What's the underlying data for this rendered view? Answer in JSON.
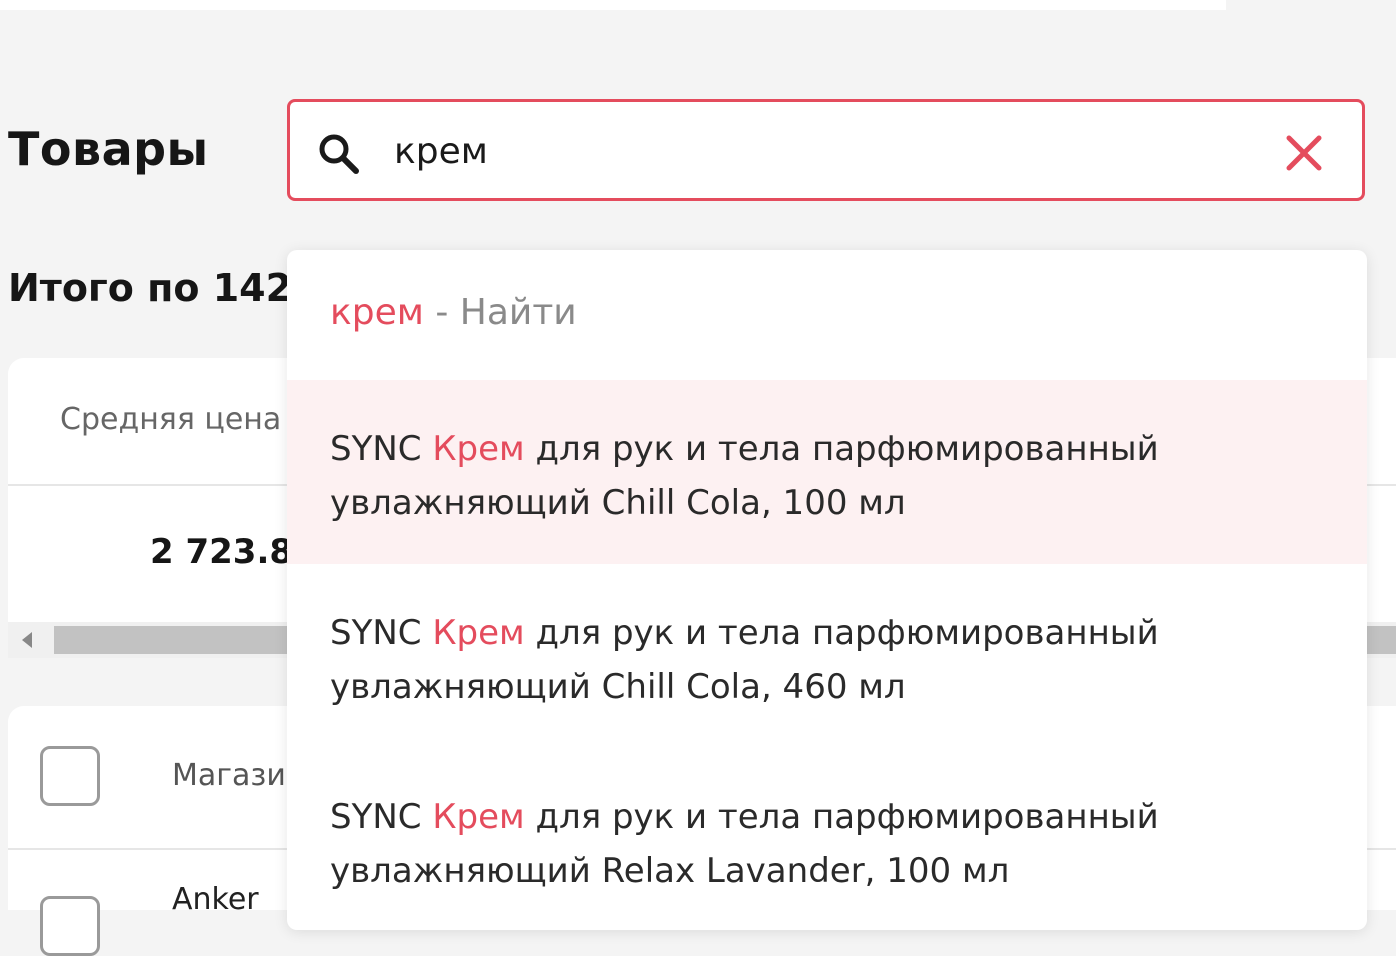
{
  "colors": {
    "accent": "#e44c5d",
    "hover_bg": "#fdf1f2",
    "page_bg": "#f4f4f4"
  },
  "page": {
    "title": "Товары"
  },
  "search": {
    "value": "крем",
    "icon": "search-icon",
    "clear_icon": "close-icon"
  },
  "totals": {
    "title": "Итого по 142"
  },
  "stats": {
    "header": "Средняя цена",
    "value": "2 723.8"
  },
  "table": {
    "header_store": "Магазин",
    "row_store": "Anker"
  },
  "dropdown": {
    "find": {
      "query": "крем",
      "separator": " - ",
      "action": "Найти"
    },
    "items": [
      {
        "prefix": "SYNC ",
        "match": "Крем",
        "rest": " для рук и тела парфюмированный увлажняющий Chill Cola, 100 мл"
      },
      {
        "prefix": "SYNC ",
        "match": "Крем",
        "rest": " для рук и тела парфюмированный увлажняющий Chill Cola, 460 мл"
      },
      {
        "prefix": "SYNC ",
        "match": "Крем",
        "rest": " для рук и тела парфюмированный увлажняющий Relax Lavander, 100 мл"
      }
    ]
  }
}
